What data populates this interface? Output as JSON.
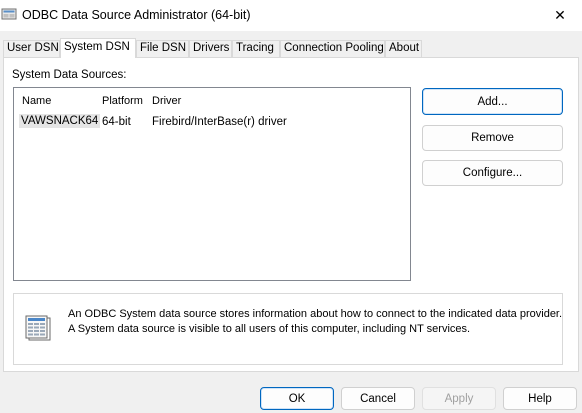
{
  "window": {
    "title": "ODBC Data Source Administrator (64-bit)",
    "close_glyph": "✕"
  },
  "tabs": [
    {
      "label": "User DSN",
      "active": false
    },
    {
      "label": "System DSN",
      "active": true
    },
    {
      "label": "File DSN",
      "active": false
    },
    {
      "label": "Drivers",
      "active": false
    },
    {
      "label": "Tracing",
      "active": false
    },
    {
      "label": "Connection Pooling",
      "active": false
    },
    {
      "label": "About",
      "active": false
    }
  ],
  "system_dsn": {
    "section_label": "System Data Sources:",
    "columns": [
      "Name",
      "Platform",
      "Driver"
    ],
    "rows": [
      {
        "name": "VAWSNACK64",
        "platform": "64-bit",
        "driver": "Firebird/InterBase(r) driver"
      }
    ],
    "buttons": {
      "add": "Add...",
      "remove": "Remove",
      "configure": "Configure..."
    },
    "info_line1": "An ODBC System data source stores information about how to connect to the indicated data provider.",
    "info_line2": "A System data source is visible to all users of this computer, including NT services."
  },
  "footer": {
    "ok": "OK",
    "cancel": "Cancel",
    "apply": "Apply",
    "help": "Help"
  },
  "icons": {
    "app": "odbc-admin-icon",
    "close": "close-icon",
    "info": "data-source-info-icon"
  },
  "colors": {
    "accent": "#0067c0",
    "selection": "#e5e5e5"
  }
}
